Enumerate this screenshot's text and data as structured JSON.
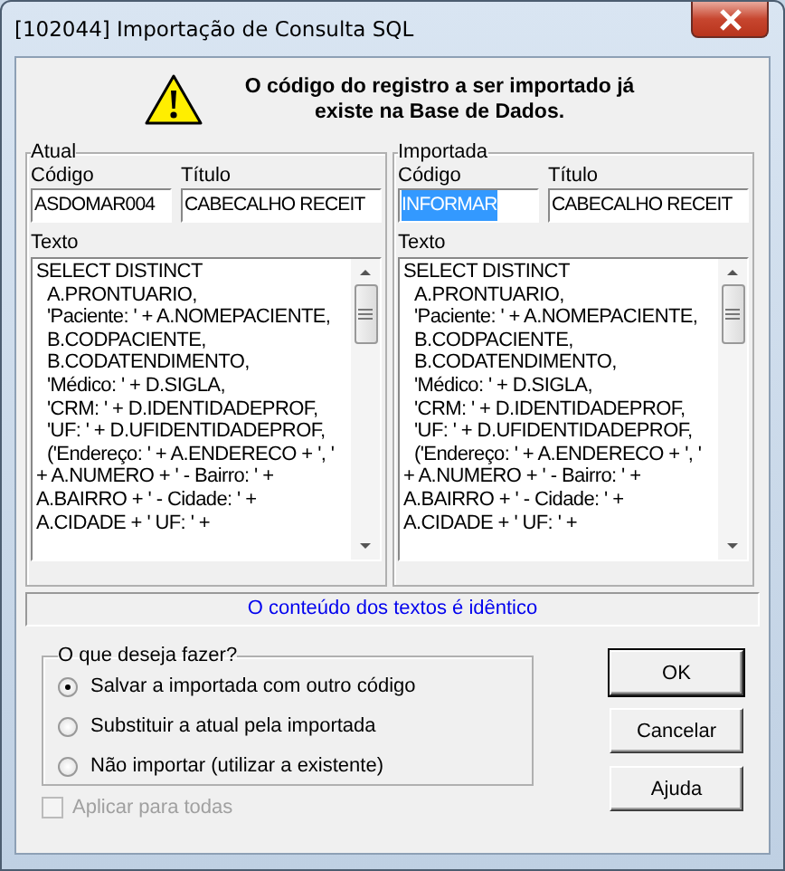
{
  "window": {
    "title": "[102044]  Importação de Consulta SQL"
  },
  "message": "O código do registro a ser importado já existe na Base de Dados.",
  "panels": [
    {
      "legend": "Atual",
      "code_label": "Código",
      "code": "ASDOMAR004",
      "code_selected": false,
      "title_label": "Título",
      "title": "CABECALHO RECEIT",
      "text_label": "Texto",
      "lines": [
        {
          "text": "SELECT DISTINCT",
          "indent": false
        },
        {
          "text": "A.PRONTUARIO,",
          "indent": true
        },
        {
          "text": "'Paciente: ' + A.NOMEPACIENTE,",
          "indent": true
        },
        {
          "text": "B.CODPACIENTE,",
          "indent": true
        },
        {
          "text": "B.CODATENDIMENTO,",
          "indent": true
        },
        {
          "text": "'Médico: ' + D.SIGLA,",
          "indent": true
        },
        {
          "text": "'CRM: ' + D.IDENTIDADEPROF,",
          "indent": true
        },
        {
          "text": "'UF: ' + D.UFIDENTIDADEPROF,",
          "indent": true
        },
        {
          "text": "('Endereço: ' + A.ENDERECO + ', '",
          "indent": true
        },
        {
          "text": "+ A.NUMERO + ' - Bairro: ' +",
          "indent": false
        },
        {
          "text": "A.BAIRRO + ' - Cidade: ' +",
          "indent": false
        },
        {
          "text": "A.CIDADE + ' UF: ' +",
          "indent": false
        }
      ]
    },
    {
      "legend": "Importada",
      "code_label": "Código",
      "code": "INFORMAR",
      "code_selected": true,
      "title_label": "Título",
      "title": "CABECALHO RECEIT",
      "text_label": "Texto",
      "lines": [
        {
          "text": "SELECT DISTINCT",
          "indent": false
        },
        {
          "text": "A.PRONTUARIO,",
          "indent": true
        },
        {
          "text": "'Paciente: ' + A.NOMEPACIENTE,",
          "indent": true
        },
        {
          "text": "B.CODPACIENTE,",
          "indent": true
        },
        {
          "text": "B.CODATENDIMENTO,",
          "indent": true
        },
        {
          "text": "'Médico: ' + D.SIGLA,",
          "indent": true
        },
        {
          "text": "'CRM: ' + D.IDENTIDADEPROF,",
          "indent": true
        },
        {
          "text": "'UF: ' + D.UFIDENTIDADEPROF,",
          "indent": true
        },
        {
          "text": "('Endereço: ' + A.ENDERECO + ', '",
          "indent": true
        },
        {
          "text": "+ A.NUMERO + ' - Bairro: ' +",
          "indent": false
        },
        {
          "text": "A.BAIRRO + ' - Cidade: ' +",
          "indent": false
        },
        {
          "text": "A.CIDADE + ' UF: ' +",
          "indent": false
        }
      ]
    }
  ],
  "status": "O conteúdo dos textos é idêntico",
  "options": {
    "legend": "O que deseja fazer?",
    "items": [
      {
        "label": "Salvar a importada com outro código",
        "selected": true
      },
      {
        "label": "Substituir a atual pela importada",
        "selected": false
      },
      {
        "label": "Não importar (utilizar a existente)",
        "selected": false
      }
    ]
  },
  "apply_all": {
    "label": "Aplicar para todas",
    "checked": false,
    "disabled": true
  },
  "buttons": [
    "OK",
    "Cancelar",
    "Ajuda"
  ]
}
